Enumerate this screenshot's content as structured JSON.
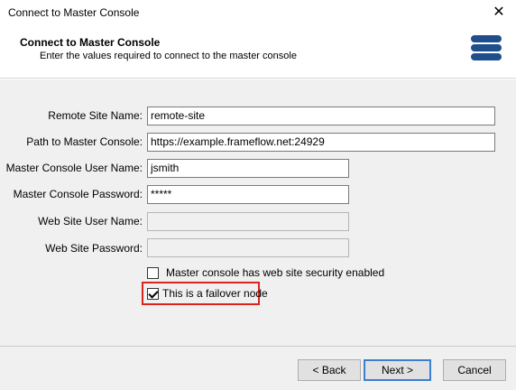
{
  "window": {
    "title": "Connect to Master Console"
  },
  "header": {
    "title": "Connect to Master Console",
    "subtitle": "Enter the values required to connect to the master console",
    "logo_icon": "stacked-bars-logo",
    "logo_color": "#1f4e8c"
  },
  "form": {
    "remote_site_name": {
      "label": "Remote Site Name:",
      "value": "remote-site"
    },
    "path_to_master": {
      "label": "Path to Master Console:",
      "value": "https://example.frameflow.net:24929"
    },
    "master_user": {
      "label": "Master Console User Name:",
      "value": "jsmith"
    },
    "master_password": {
      "label": "Master Console Password:",
      "value": "*****"
    },
    "web_user": {
      "label": "Web Site User Name:",
      "value": ""
    },
    "web_password": {
      "label": "Web Site Password:",
      "value": ""
    }
  },
  "options": {
    "web_security": {
      "label": "Master console has web site security enabled",
      "checked": false
    },
    "failover": {
      "label": "This is a failover node",
      "checked": true
    }
  },
  "buttons": {
    "back": "< Back",
    "next": "Next >",
    "cancel": "Cancel"
  },
  "colors": {
    "highlight": "#d9261c",
    "default_button_border": "#3c7fd1"
  }
}
